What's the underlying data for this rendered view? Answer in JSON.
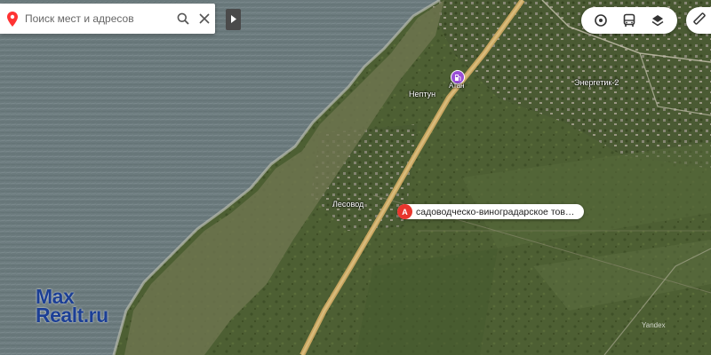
{
  "search": {
    "placeholder": "Поиск мест и адресов",
    "icons": [
      "map-pin-icon",
      "search-icon",
      "close-icon"
    ]
  },
  "collapse_panel": {
    "icon": "chevron-right-icon"
  },
  "layers": {
    "icons": [
      "panorama-icon",
      "transport-icon",
      "layers-icon"
    ],
    "ruler_icon": "ruler-icon"
  },
  "map": {
    "type": "satellite",
    "labels": {
      "neptun": "Нептун",
      "atan": "Атан",
      "energetik": "Энергетик-2",
      "lesovod": "Лесовод"
    },
    "poi_icon": "fuel-station-icon",
    "copyright": "Yandex"
  },
  "marker": {
    "letter": "А",
    "label": "садоводческо-виноградарское товарищество",
    "color": "#e8362d"
  },
  "watermark": {
    "line1": "Max",
    "line2": "Realt.ru",
    "color": "#1c3f95"
  }
}
